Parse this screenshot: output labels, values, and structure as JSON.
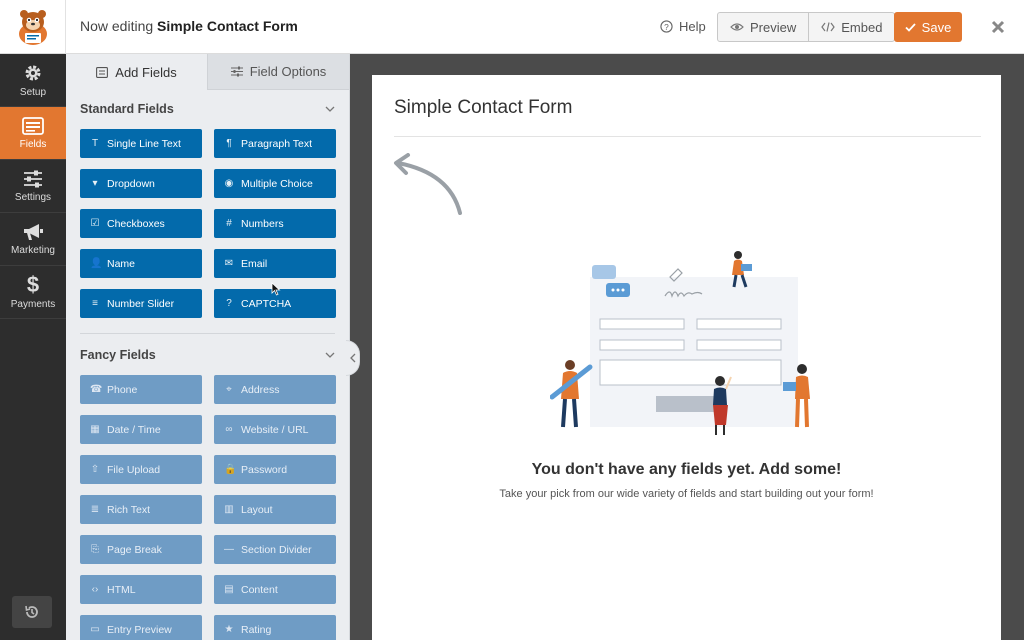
{
  "topbar": {
    "editing_prefix": "Now editing",
    "form_name": "Simple Contact Form",
    "help_label": "Help",
    "preview_label": "Preview",
    "embed_label": "Embed",
    "save_label": "Save"
  },
  "nav": [
    {
      "label": "Setup",
      "icon": "gear-icon"
    },
    {
      "label": "Fields",
      "icon": "fields-icon",
      "active": true
    },
    {
      "label": "Settings",
      "icon": "sliders-icon"
    },
    {
      "label": "Marketing",
      "icon": "megaphone-icon"
    },
    {
      "label": "Payments",
      "icon": "dollar-icon"
    }
  ],
  "panel": {
    "tabs": {
      "add_fields": "Add Fields",
      "field_options": "Field Options"
    },
    "standard": {
      "title": "Standard Fields",
      "fields": [
        {
          "label": "Single Line Text",
          "icon": "T"
        },
        {
          "label": "Paragraph Text",
          "icon": "¶"
        },
        {
          "label": "Dropdown",
          "icon": "▾"
        },
        {
          "label": "Multiple Choice",
          "icon": "◉"
        },
        {
          "label": "Checkboxes",
          "icon": "☑"
        },
        {
          "label": "Numbers",
          "icon": "#"
        },
        {
          "label": "Name",
          "icon": "👤"
        },
        {
          "label": "Email",
          "icon": "✉"
        },
        {
          "label": "Number Slider",
          "icon": "≡"
        },
        {
          "label": "CAPTCHA",
          "icon": "?"
        }
      ]
    },
    "fancy": {
      "title": "Fancy Fields",
      "fields": [
        {
          "label": "Phone",
          "icon": "☎"
        },
        {
          "label": "Address",
          "icon": "⌖"
        },
        {
          "label": "Date / Time",
          "icon": "▦"
        },
        {
          "label": "Website / URL",
          "icon": "∞"
        },
        {
          "label": "File Upload",
          "icon": "⇧"
        },
        {
          "label": "Password",
          "icon": "🔒"
        },
        {
          "label": "Rich Text",
          "icon": "≣"
        },
        {
          "label": "Layout",
          "icon": "▥"
        },
        {
          "label": "Page Break",
          "icon": "⎘"
        },
        {
          "label": "Section Divider",
          "icon": "—"
        },
        {
          "label": "HTML",
          "icon": "‹›"
        },
        {
          "label": "Content",
          "icon": "▤"
        },
        {
          "label": "Entry Preview",
          "icon": "▭"
        },
        {
          "label": "Rating",
          "icon": "★"
        }
      ]
    }
  },
  "preview": {
    "form_title": "Simple Contact Form",
    "empty_heading": "You don't have any fields yet. Add some!",
    "empty_text": "Take your pick from our wide variety of fields and start building out your form!"
  },
  "colors": {
    "accent": "#e27730",
    "field_button": "#036aab",
    "nav_bg": "#2d2d2d"
  }
}
